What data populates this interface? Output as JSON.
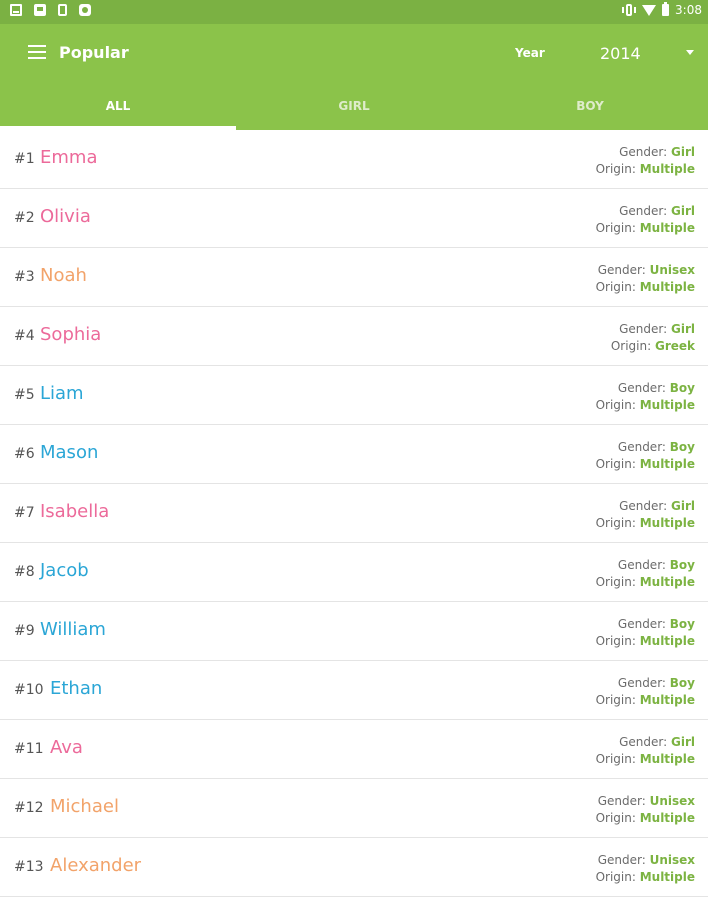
{
  "status_bar": {
    "time": "3:08"
  },
  "app_bar": {
    "title": "Popular",
    "year_label": "Year",
    "year_value": "2014",
    "icons": {
      "menu": "hamburger-menu-icon",
      "dropdown": "dropdown-arrow-icon"
    }
  },
  "tabs": [
    {
      "label": "ALL",
      "selected": true
    },
    {
      "label": "GIRL",
      "selected": false
    },
    {
      "label": "BOY",
      "selected": false
    }
  ],
  "colors": {
    "app_bar": "#8bc34a",
    "status_bar": "#7bb143",
    "girl": "#ec6a9a",
    "boy": "#2ba6d6",
    "unisex": "#f2a36a",
    "detail_value": "#7cb342"
  },
  "labels": {
    "gender": "Gender: ",
    "origin": "Origin: "
  },
  "names": [
    {
      "rank": "#1",
      "name": "Emma",
      "gender": "Girl",
      "origin": "Multiple"
    },
    {
      "rank": "#2",
      "name": "Olivia",
      "gender": "Girl",
      "origin": "Multiple"
    },
    {
      "rank": "#3",
      "name": "Noah",
      "gender": "Unisex",
      "origin": "Multiple"
    },
    {
      "rank": "#4",
      "name": "Sophia",
      "gender": "Girl",
      "origin": "Greek"
    },
    {
      "rank": "#5",
      "name": "Liam",
      "gender": "Boy",
      "origin": "Multiple"
    },
    {
      "rank": "#6",
      "name": "Mason",
      "gender": "Boy",
      "origin": "Multiple"
    },
    {
      "rank": "#7",
      "name": "Isabella",
      "gender": "Girl",
      "origin": "Multiple"
    },
    {
      "rank": "#8",
      "name": "Jacob",
      "gender": "Boy",
      "origin": "Multiple"
    },
    {
      "rank": "#9",
      "name": "William",
      "gender": "Boy",
      "origin": "Multiple"
    },
    {
      "rank": "#10",
      "name": "Ethan",
      "gender": "Boy",
      "origin": "Multiple"
    },
    {
      "rank": "#11",
      "name": "Ava",
      "gender": "Girl",
      "origin": "Multiple"
    },
    {
      "rank": "#12",
      "name": "Michael",
      "gender": "Unisex",
      "origin": "Multiple"
    },
    {
      "rank": "#13",
      "name": "Alexander",
      "gender": "Unisex",
      "origin": "Multiple"
    }
  ]
}
